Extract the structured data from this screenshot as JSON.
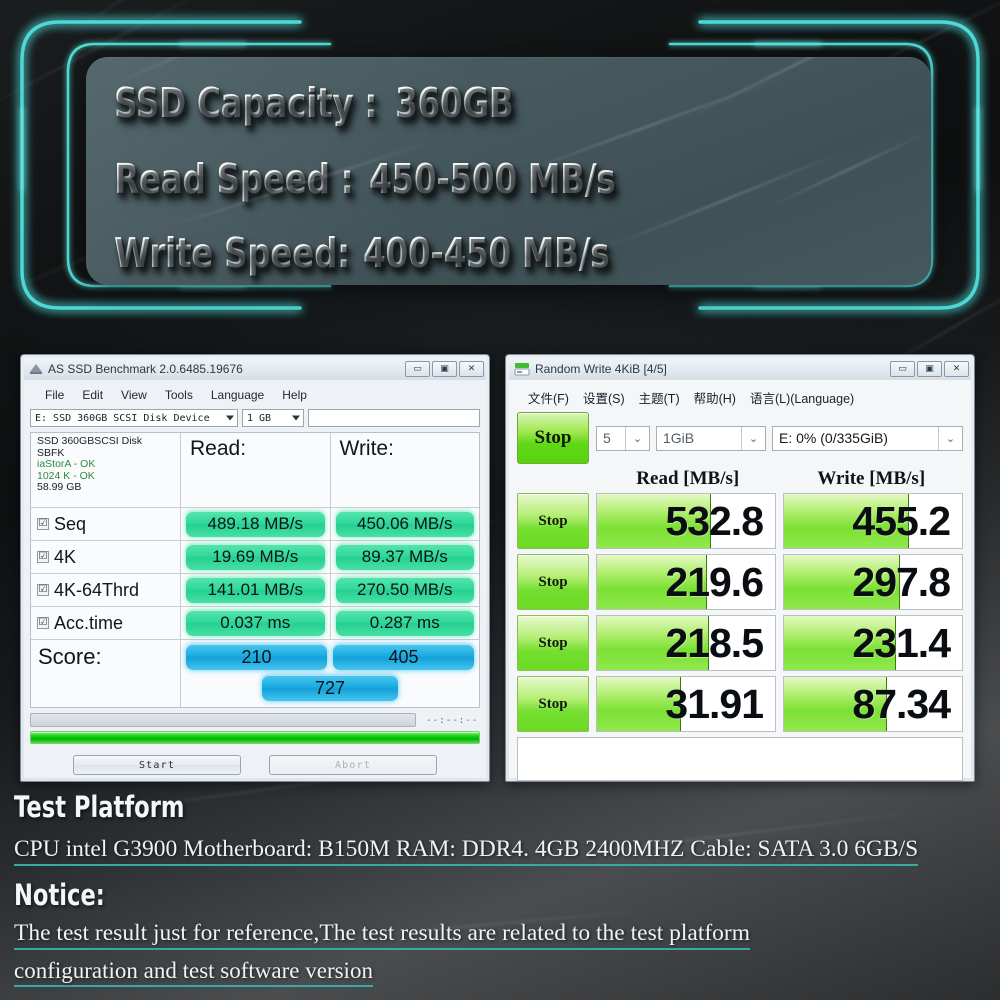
{
  "header": {
    "specs": [
      {
        "label": "SSD Capacity :",
        "value": "360GB"
      },
      {
        "label": "Read Speed :",
        "value": "450-500 MB/s"
      },
      {
        "label": "Write Speed:",
        "value": "400-450 MB/s"
      }
    ]
  },
  "as_ssd": {
    "title": "AS SSD Benchmark 2.0.6485.19676",
    "icon": "as-ssd-app-icon",
    "window_buttons": {
      "minimize": "—",
      "maximize": "❐",
      "close": "✕"
    },
    "menu": [
      "File",
      "Edit",
      "View",
      "Tools",
      "Language",
      "Help"
    ],
    "drive_combo": "E: SSD 360GB SCSI Disk Device",
    "size_combo": "1 GB",
    "info": {
      "line1": "SSD 360GBSCSI Disk",
      "line2": "SBFK",
      "line3": "iaStorA - OK",
      "line4": "1024 K - OK",
      "line5": "58.99 GB"
    },
    "col_read": "Read:",
    "col_write": "Write:",
    "rows": [
      {
        "label": "Seq",
        "checked": "☑",
        "read": "489.18 MB/s",
        "write": "450.06 MB/s"
      },
      {
        "label": "4K",
        "checked": "☑",
        "read": "19.69 MB/s",
        "write": "89.37 MB/s"
      },
      {
        "label": "4K-64Thrd",
        "checked": "☑",
        "read": "141.01 MB/s",
        "write": "270.50 MB/s"
      },
      {
        "label": "Acc.time",
        "checked": "☑",
        "read": "0.037 ms",
        "write": "0.287 ms"
      }
    ],
    "score_label": "Score:",
    "score_read": "210",
    "score_write": "405",
    "score_total": "727",
    "timer": "--:--:--",
    "start_button": "Start",
    "abort_button": "Abort"
  },
  "cdm": {
    "title": "Random Write 4KiB [4/5]",
    "icon": "crystaldiskmark-app-icon",
    "window_buttons": {
      "minimize": "—",
      "maximize": "❐",
      "close": "✕"
    },
    "menu": [
      "文件(F)",
      "设置(S)",
      "主题(T)",
      "帮助(H)",
      "语言(L)(Language)"
    ],
    "stop_main": "Stop",
    "select_count": "5",
    "select_size": "1GiB",
    "select_drive": "E: 0% (0/335GiB)",
    "col_read": "Read [MB/s]",
    "col_write": "Write [MB/s]",
    "rows": [
      {
        "stop": "Stop",
        "read": "532.8",
        "write": "455.2",
        "read_fill_pct": 64,
        "write_fill_pct": 70
      },
      {
        "stop": "Stop",
        "read": "219.6",
        "write": "297.8",
        "read_fill_pct": 62,
        "write_fill_pct": 65
      },
      {
        "stop": "Stop",
        "read": "218.5",
        "write": "231.4",
        "read_fill_pct": 63,
        "write_fill_pct": 63
      },
      {
        "stop": "Stop",
        "read": "31.91",
        "write": "87.34",
        "read_fill_pct": 47,
        "write_fill_pct": 58
      }
    ]
  },
  "bottom": {
    "platform_title": "Test Platform",
    "platform_line": "CPU intel G3900  Motherboard: B150M    RAM: DDR4. 4GB 2400MHZ   Cable: SATA 3.0  6GB/S",
    "notice_title": "Notice:",
    "notice_line1": "The test result just for reference,The test results are related to the test platform",
    "notice_line2": "configuration  and test software version"
  },
  "colors": {
    "accent_cyan": "#4fd9d6",
    "panel_teal": "#45585d",
    "pill_green": "#2fd89a",
    "pill_blue": "#17a9e0",
    "bar_green": "#7ce034",
    "underline_teal": "#3aa9a2"
  }
}
